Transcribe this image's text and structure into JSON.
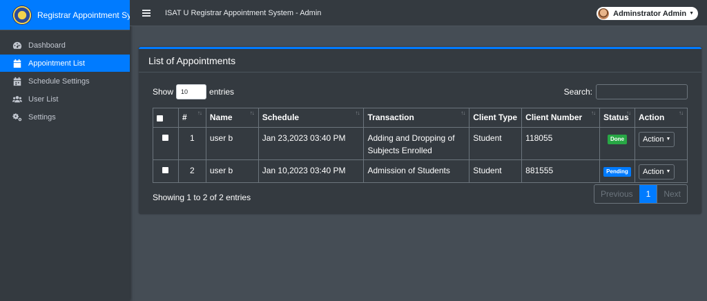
{
  "brand": {
    "title": "Registrar Appointment System"
  },
  "topbar": {
    "title": "ISAT U Registrar Appointment System - Admin",
    "user": "Adminstrator Admin"
  },
  "sidebar": {
    "items": [
      {
        "label": "Dashboard",
        "icon": "tachometer-icon"
      },
      {
        "label": "Appointment List",
        "icon": "calendar-icon",
        "active": true
      },
      {
        "label": "Schedule Settings",
        "icon": "calendar-settings-icon"
      },
      {
        "label": "User List",
        "icon": "users-icon"
      },
      {
        "label": "Settings",
        "icon": "cogs-icon"
      }
    ]
  },
  "card": {
    "title": "List of Appointments"
  },
  "controls": {
    "show_label": "Show",
    "length_value": "10",
    "entries_label": "entries",
    "search_label": "Search:"
  },
  "table": {
    "headers": [
      "#",
      "Name",
      "Schedule",
      "Transaction",
      "Client Type",
      "Client Number",
      "Status",
      "Action"
    ],
    "rows": [
      {
        "num": "1",
        "name": "user b",
        "schedule": "Jan 23,2023 03:40 PM",
        "transaction": "Adding and Dropping of Subjects Enrolled",
        "client_type": "Student",
        "client_number": "118055",
        "status": "Done",
        "action": "Action"
      },
      {
        "num": "2",
        "name": "user b",
        "schedule": "Jan 10,2023 03:40 PM",
        "transaction": "Admission of Students",
        "client_type": "Student",
        "client_number": "881555",
        "status": "Pending",
        "action": "Action"
      }
    ]
  },
  "footer": {
    "info": "Showing 1 to 2 of 2 entries",
    "previous": "Previous",
    "page": "1",
    "next": "Next"
  },
  "colors": {
    "primary": "#007bff",
    "success": "#28a745",
    "dark": "#343a40",
    "body": "#454d55"
  }
}
